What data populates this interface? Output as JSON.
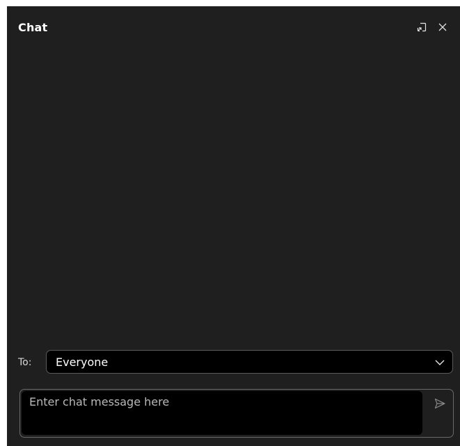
{
  "header": {
    "title": "Chat",
    "icons": [
      "popout-icon",
      "close-icon"
    ]
  },
  "recipient": {
    "label": "To:",
    "selected": "Everyone"
  },
  "composer": {
    "placeholder": "Enter chat message here",
    "value": ""
  },
  "colors": {
    "panel_bg": "#1f1f1f",
    "field_bg": "#000000",
    "text": "#ffffff",
    "border": "#5b5b5b"
  }
}
